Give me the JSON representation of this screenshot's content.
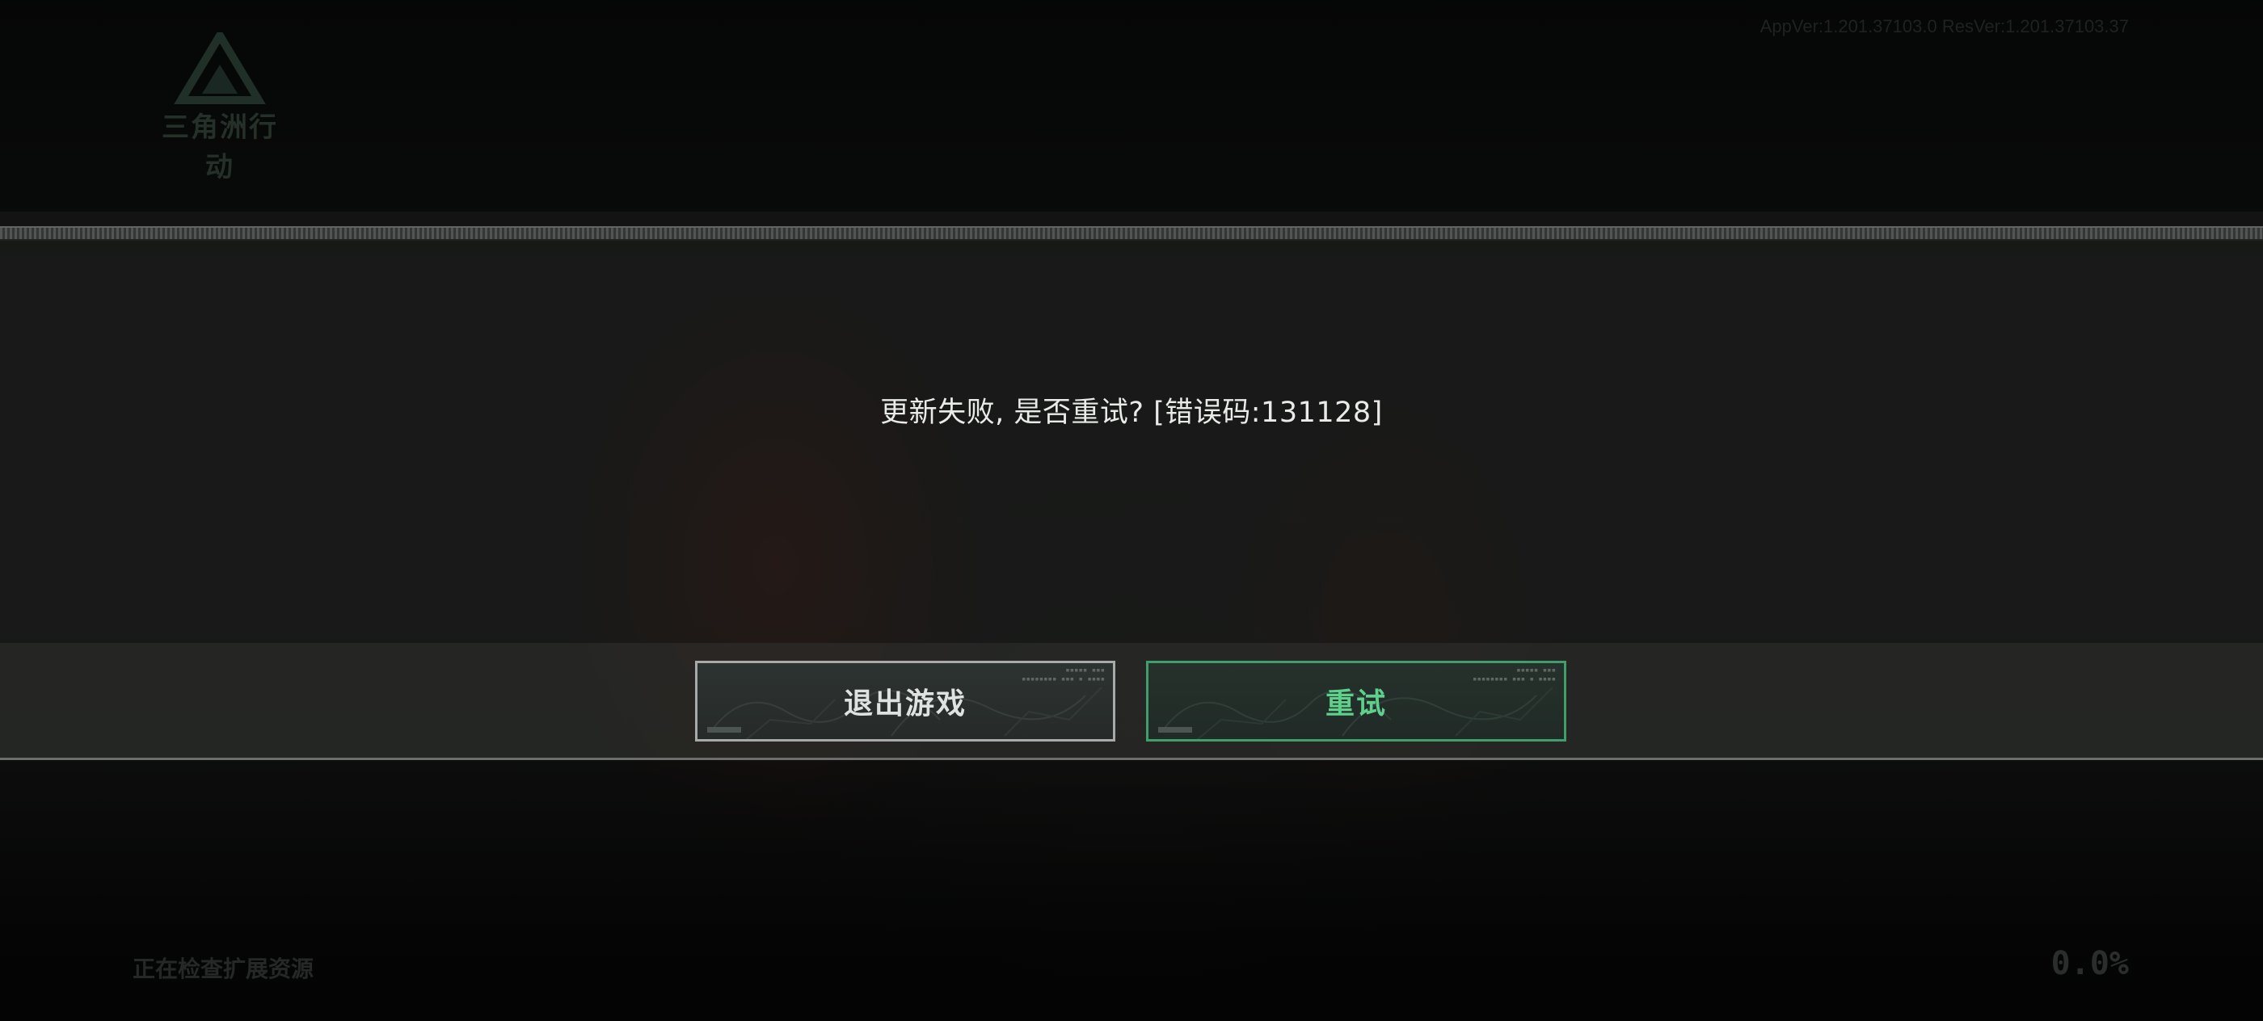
{
  "header": {
    "logo_text": "三角洲行动",
    "version": "AppVer:1.201.37103.0 ResVer:1.201.37103.37"
  },
  "dialog": {
    "message": "更新失败, 是否重试? [错误码:131128]",
    "exit_label": "退出游戏",
    "retry_label": "重试",
    "exit_border_color": "#a7aaa8",
    "retry_accent_color": "#5fd08c"
  },
  "footer": {
    "status": "正在检查扩展资源",
    "progress_percent": "0.0%"
  }
}
